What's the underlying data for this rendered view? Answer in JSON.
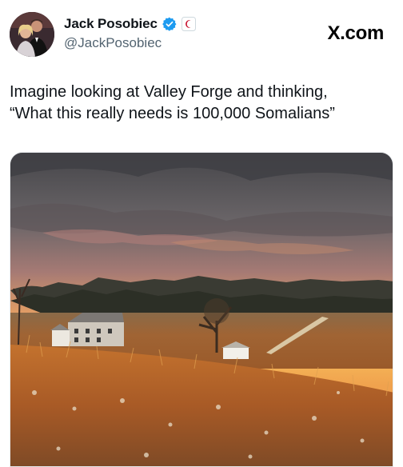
{
  "author": {
    "display_name": "Jack Posobiec",
    "handle": "@JackPosobiec",
    "avatar_icon": "profile-photo",
    "verified_icon": "verified-badge-icon",
    "verified_color": "#1d9bf0",
    "affiliation_icon": "affiliation-badge-icon",
    "affiliation_color": "#c8102e"
  },
  "brand": {
    "label": "X.com"
  },
  "tweet": {
    "lines": [
      "Imagine looking at Valley Forge and thinking,",
      "“What this really needs is 100,000 Somalians”"
    ]
  },
  "media": {
    "type": "photo",
    "icon": "landscape-photo",
    "sky_colors": [
      "#4f4f52",
      "#a3787a",
      "#e8a060",
      "#f4b45a"
    ],
    "field_color": "#b8712f"
  }
}
